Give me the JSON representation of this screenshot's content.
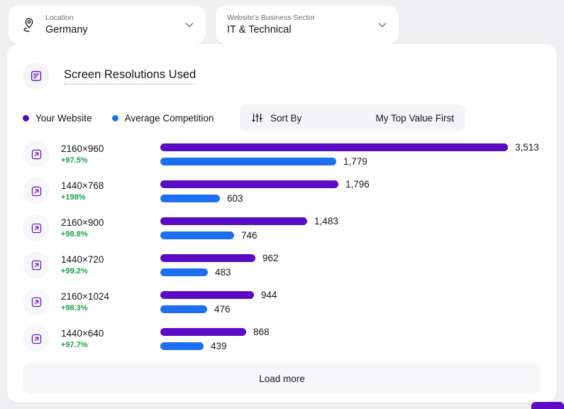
{
  "filters": [
    {
      "name": "location",
      "label": "Location",
      "value": "Germany",
      "icon": "map-pin-icon"
    },
    {
      "name": "sector",
      "label": "Website's Business Sector",
      "value": "IT & Technical",
      "icon": "chevron-down-icon"
    }
  ],
  "card": {
    "title": "Screen Resolutions Used",
    "title_icon": "document-list-icon"
  },
  "legend": [
    {
      "label": "Your Website",
      "color": "#5b0bc4"
    },
    {
      "label": "Average Competition",
      "color": "#1c6ff0"
    }
  ],
  "sort": {
    "icon": "sliders-icon",
    "label": "Sort By",
    "value": "My Top Value First"
  },
  "footer": {
    "load_more_label": "Load more"
  },
  "colors": {
    "mine": "#5b0bc4",
    "competition": "#1c6ff0",
    "delta_positive": "#16a34a",
    "page_background": "#f0f0f2",
    "card_background": "#ffffff"
  },
  "chart_data": {
    "type": "bar",
    "title": "Screen Resolutions Used",
    "orientation": "horizontal",
    "categories": [
      "2160×960",
      "1440×768",
      "2160×900",
      "1440×720",
      "2160×1024",
      "1440×640"
    ],
    "series": [
      {
        "name": "Your Website",
        "color": "#5b0bc4",
        "values": [
          3513,
          1796,
          1483,
          962,
          944,
          868
        ],
        "value_labels": [
          "3,513",
          "1,796",
          "1,483",
          "962",
          "944",
          "868"
        ]
      },
      {
        "name": "Average Competition",
        "color": "#1c6ff0",
        "values": [
          1779,
          603,
          746,
          483,
          476,
          439
        ],
        "value_labels": [
          "1,779",
          "603",
          "746",
          "483",
          "476",
          "439"
        ]
      }
    ],
    "deltas": [
      "+97.5%",
      "+198%",
      "+98.8%",
      "+99.2%",
      "+98.3%",
      "+97.7%"
    ],
    "xlabel": "",
    "ylabel": "",
    "xlim": [
      0,
      3513
    ],
    "grid": false,
    "legend_position": "top-left",
    "max_value": 3513
  }
}
